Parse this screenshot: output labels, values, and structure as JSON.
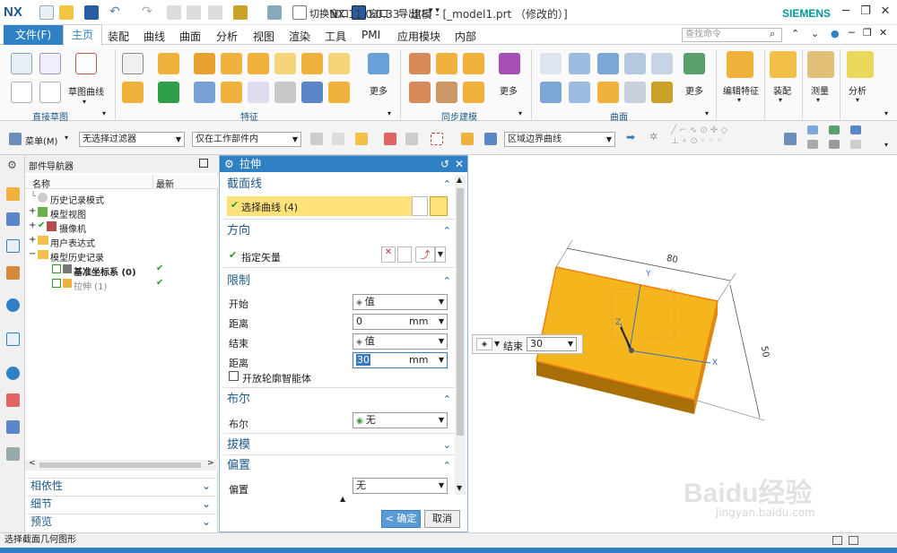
{
  "app": {
    "logo": "NX",
    "title": "NX 11.0.0.33 - 建模 - [_model1.prt （修改的）]",
    "brand": "SIEMENS"
  },
  "quick_access": {
    "switch_window": "切换窗口",
    "window": "窗口",
    "export": "导出(E)"
  },
  "tabs": [
    "文件(F)",
    "主页",
    "装配",
    "曲线",
    "曲面",
    "分析",
    "视图",
    "渲染",
    "工具",
    "PMI",
    "应用模块",
    "内部"
  ],
  "search": {
    "placeholder": "查找命令"
  },
  "ribbon": {
    "sketch_curve_label": "草图曲线",
    "more1": "更多",
    "more2": "更多",
    "more3": "更多",
    "edit_feature": "编辑特征",
    "assembly": "装配",
    "measure": "测量",
    "analysis": "分析",
    "groups": {
      "direct_sketch": "直接草图",
      "feature": "特征",
      "sync_modeling": "同步建模",
      "surface": "曲面"
    }
  },
  "toolbar2": {
    "menu": "菜单(M)",
    "filter": "无选择过滤器",
    "scope": "仅在工作部件内",
    "curve_rule": "区域边界曲线"
  },
  "navigator": {
    "title": "部件导航器",
    "col_name": "名称",
    "col_latest": "最新",
    "rows": [
      {
        "label": "历史记录模式",
        "latest": ""
      },
      {
        "label": "模型视图",
        "latest": ""
      },
      {
        "label": "摄像机",
        "latest": ""
      },
      {
        "label": "用户表达式",
        "latest": ""
      },
      {
        "label": "模型历史记录",
        "latest": ""
      },
      {
        "label": "基准坐标系 (0)",
        "latest": "✔"
      },
      {
        "label": "拉伸 (1)",
        "latest": "✔"
      }
    ],
    "footer": [
      "相依性",
      "细节",
      "预览"
    ]
  },
  "dialog": {
    "title": "拉伸",
    "section_curve": {
      "header": "截面线",
      "select_curve": "选择曲线 (4)"
    },
    "direction": {
      "header": "方向",
      "vector": "指定矢量"
    },
    "limits": {
      "header": "限制",
      "start_label": "开始",
      "start_value": "值",
      "distance1_label": "距离",
      "distance1_value": "0",
      "distance1_unit": "mm",
      "end_label": "结束",
      "end_value": "值",
      "distance2_label": "距离",
      "distance2_value": "30",
      "distance2_unit": "mm",
      "open_profile": "开放轮廓智能体"
    },
    "boolean": {
      "header": "布尔",
      "label": "布尔",
      "value": "无"
    },
    "draft": {
      "header": "拔模"
    },
    "offset": {
      "header": "偏置",
      "label": "偏置",
      "value": "无"
    },
    "ok": "< 确定 >",
    "cancel": "取消"
  },
  "viewport": {
    "dim_top": "80",
    "dim_right": "50",
    "axis_x": "X",
    "axis_y": "Y",
    "axis_z": "Z",
    "onscreen_end_label": "结束",
    "onscreen_end_value": "30",
    "watermark": "Baidu经验",
    "watermark_url": "jingyan.baidu.com"
  },
  "status": {
    "text": "选择截面几何图形"
  },
  "colors": {
    "accent": "#2f80c4",
    "solid": "#f5b51c",
    "highlight": "#ffe27a"
  }
}
